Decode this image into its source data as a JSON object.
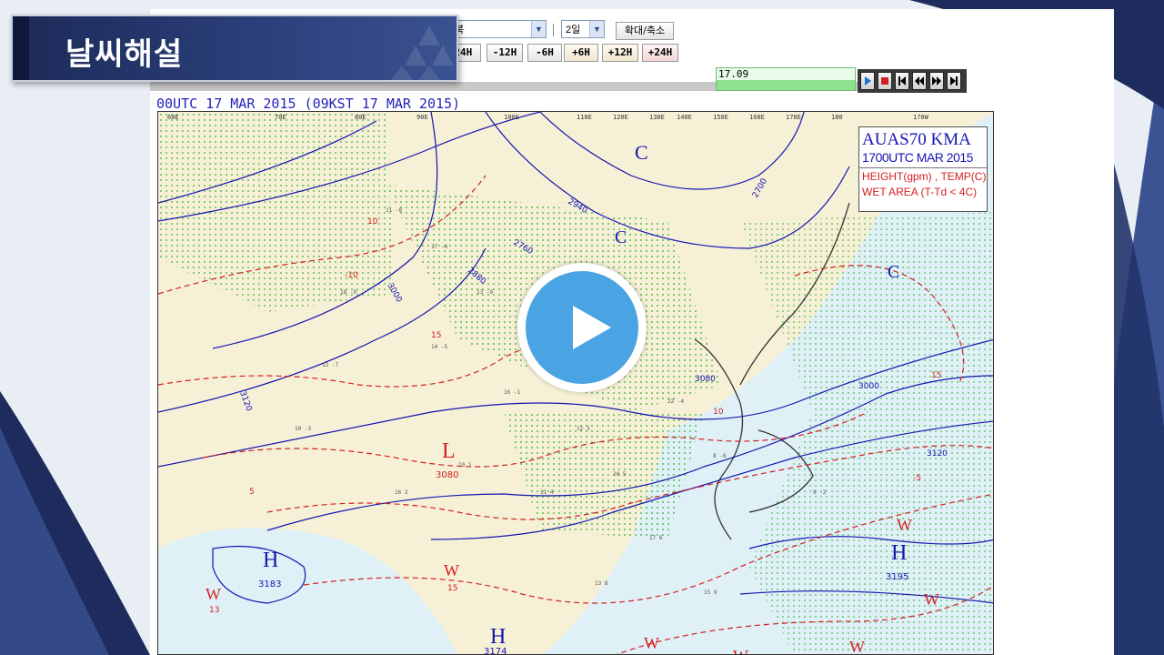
{
  "slide": {
    "title": "날씨해설"
  },
  "toolbar": {
    "select_a_value": "북",
    "select_b_value": "2일",
    "zoom_button": "확대/축소",
    "step_buttons": [
      "-24H",
      "-12H",
      "-6H",
      "+6H",
      "+12H",
      "+24H"
    ]
  },
  "timeline": {
    "current_time": "17.09"
  },
  "map": {
    "caption": "00UTC 17 MAR 2015 (09KST 17 MAR 2015)",
    "legend": {
      "line1": "AUAS70 KMA",
      "line2": "1700UTC MAR 2015",
      "line3": "HEIGHT(gpm) , TEMP(C)",
      "line4": "WET AREA (T-Td < 4C)"
    },
    "longitudes": [
      "60E",
      "70E",
      "80E",
      "90E",
      "100E",
      "110E",
      "120E",
      "130E",
      "140E",
      "150E",
      "160E",
      "170E",
      "180",
      "170W"
    ],
    "systems": [
      {
        "symbol": "C",
        "value": "",
        "kind": "cold"
      },
      {
        "symbol": "C",
        "value": "",
        "kind": "cold"
      },
      {
        "symbol": "C",
        "value": "",
        "kind": "cold"
      },
      {
        "symbol": "L",
        "value": "3080",
        "kind": "low"
      },
      {
        "symbol": "H",
        "value": "3183",
        "kind": "high"
      },
      {
        "symbol": "H",
        "value": "3174",
        "kind": "high"
      },
      {
        "symbol": "H",
        "value": "3195",
        "kind": "high"
      },
      {
        "symbol": "W",
        "value": "13",
        "kind": "warm"
      },
      {
        "symbol": "W",
        "value": "15",
        "kind": "warm"
      },
      {
        "symbol": "W",
        "value": "",
        "kind": "warm"
      },
      {
        "symbol": "W",
        "value": "",
        "kind": "warm"
      },
      {
        "symbol": "W",
        "value": "",
        "kind": "warm"
      },
      {
        "symbol": "W",
        "value": "",
        "kind": "warm"
      },
      {
        "symbol": "W",
        "value": "",
        "kind": "warm"
      }
    ],
    "contour_labels": [
      "3000",
      "3120",
      "3080",
      "2880",
      "2940",
      "2760",
      "2700",
      "3000",
      "3120",
      "15",
      "10",
      "5",
      "-5",
      "10",
      "15",
      "-10"
    ]
  },
  "video": {
    "play_icon": "play-icon"
  },
  "colors": {
    "banner": "#1c2a58",
    "play": "#4aa3e3",
    "contour": "#1515b0",
    "isotherm": "#d42020",
    "land": "#f6f0d6",
    "sea": "#dff0f7",
    "wet": "#22aa22"
  }
}
